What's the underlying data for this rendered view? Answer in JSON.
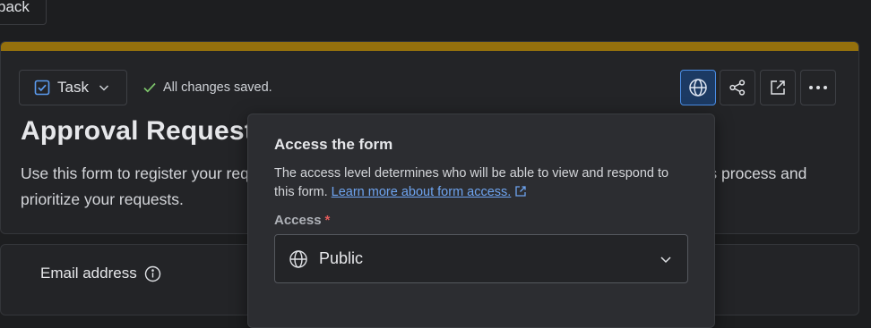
{
  "back_button": {
    "label": "back"
  },
  "header": {
    "accent_color": "#94700d",
    "item_type": {
      "label": "Task",
      "icon": "checkbox-icon"
    },
    "save_status": "All changes saved.",
    "toolbar": [
      {
        "name": "globe-button",
        "icon": "globe-icon",
        "active": true
      },
      {
        "name": "share-button",
        "icon": "share-icon"
      },
      {
        "name": "open-external-button",
        "icon": "external-link-icon"
      },
      {
        "name": "more-button",
        "icon": "ellipsis-icon"
      }
    ],
    "title": "Approval Requests",
    "description": "Use this form to register your requests for approval. Providing as much detail as possible will help us process and prioritize your requests."
  },
  "field": {
    "label": "Email address",
    "icon": "info-icon"
  },
  "access_popover": {
    "title": "Access the form",
    "description": "The access level determines who will be able to view and respond to this form. ",
    "link_text": "Learn more about form access.",
    "access_label": "Access",
    "required_marker": "*",
    "selected_value": "Public",
    "selected_icon": "globe-icon"
  }
}
